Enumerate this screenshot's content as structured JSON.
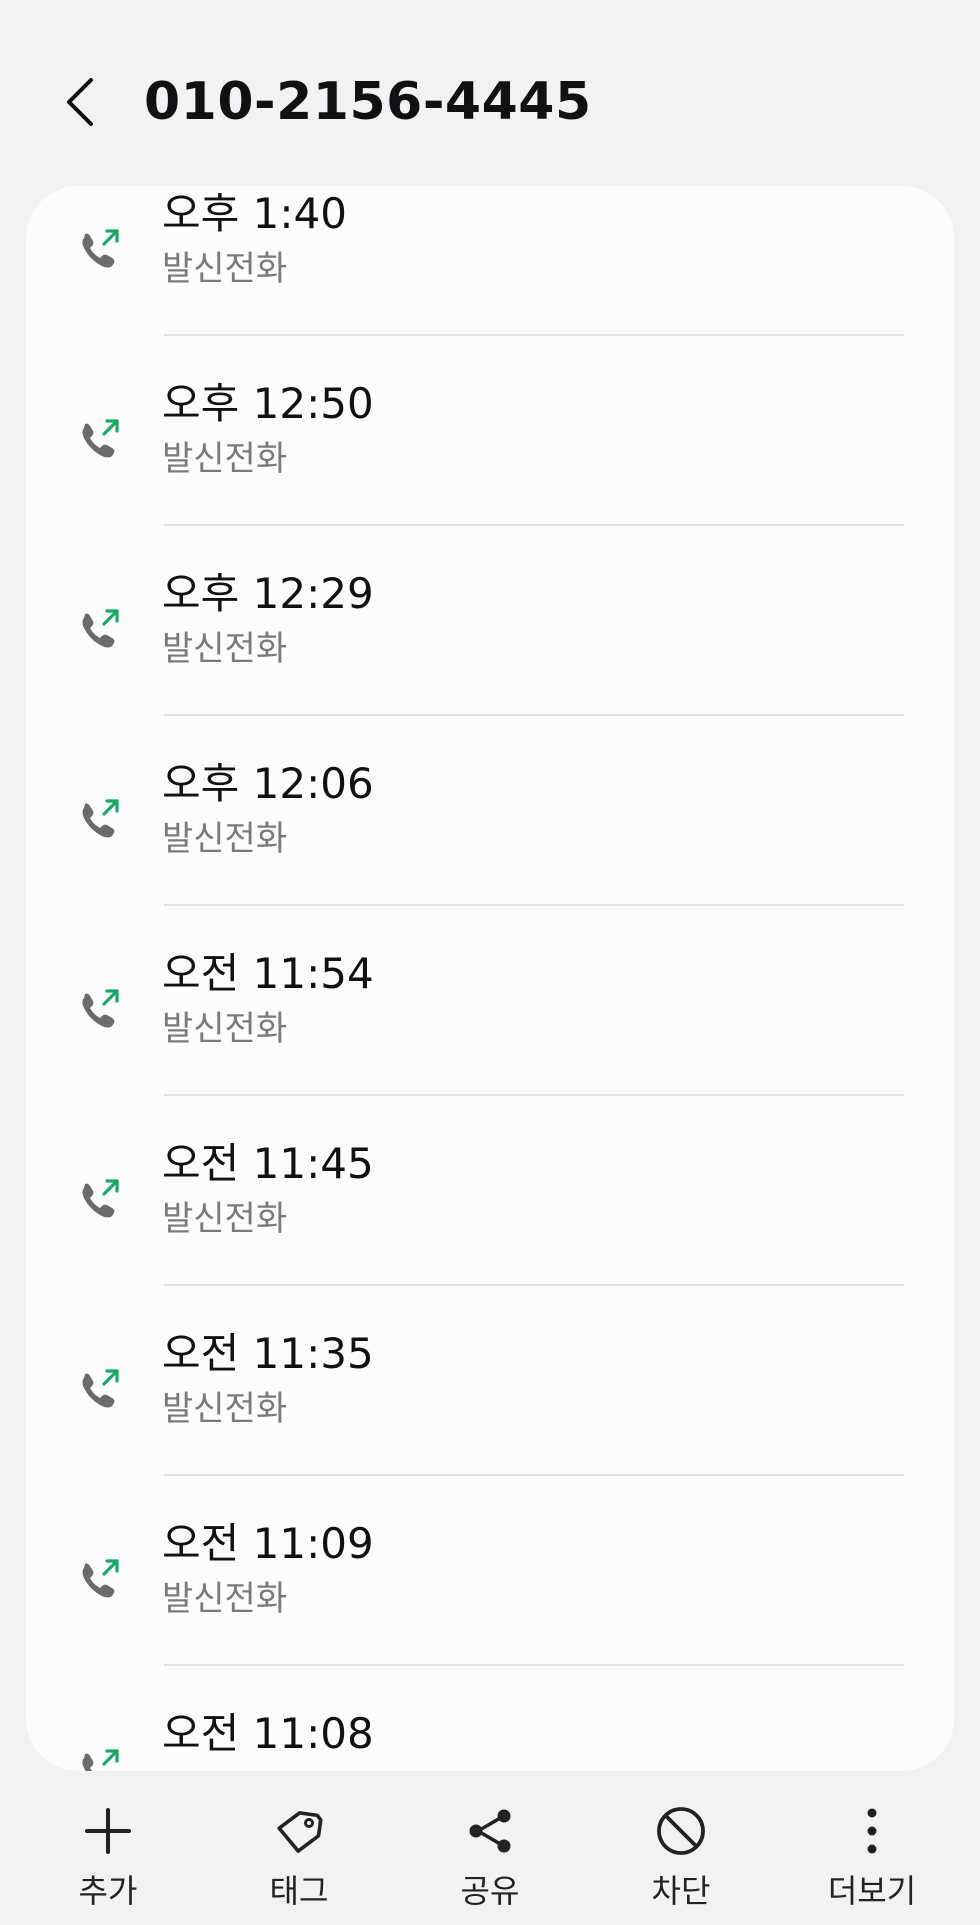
{
  "header": {
    "title": "010-2156-4445"
  },
  "calls": [
    {
      "time": "오후 1:40",
      "type": "발신전화"
    },
    {
      "time": "오후 12:50",
      "type": "발신전화"
    },
    {
      "time": "오후 12:29",
      "type": "발신전화"
    },
    {
      "time": "오후 12:06",
      "type": "발신전화"
    },
    {
      "time": "오전 11:54",
      "type": "발신전화"
    },
    {
      "time": "오전 11:45",
      "type": "발신전화"
    },
    {
      "time": "오전 11:35",
      "type": "발신전화"
    },
    {
      "time": "오전 11:09",
      "type": "발신전화"
    },
    {
      "time": "오전 11:08",
      "type": ""
    }
  ],
  "actions": [
    {
      "label": "추가",
      "icon": "plus-icon"
    },
    {
      "label": "태그",
      "icon": "tag-icon"
    },
    {
      "label": "공유",
      "icon": "share-icon"
    },
    {
      "label": "차단",
      "icon": "block-icon"
    },
    {
      "label": "더보기",
      "icon": "more-vertical-icon"
    }
  ],
  "colors": {
    "outgoing_arrow": "#1aa865",
    "phone_handset": "#6b6b6e"
  }
}
